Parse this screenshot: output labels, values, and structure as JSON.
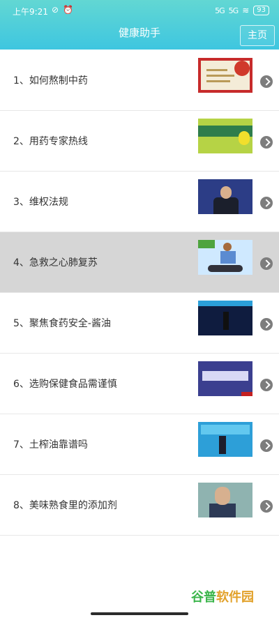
{
  "status_bar": {
    "time": "上午9:21",
    "sig1": "5G",
    "sig2": "5G",
    "wifi": "≋",
    "battery": "93"
  },
  "header": {
    "title": "健康助手",
    "home_label": "主页"
  },
  "items": [
    {
      "label": "1、如何熬制中药"
    },
    {
      "label": "2、用药专家热线"
    },
    {
      "label": "3、维权法规"
    },
    {
      "label": "4、急救之心肺复苏",
      "selected": true
    },
    {
      "label": "5、聚焦食药安全-酱油"
    },
    {
      "label": "6、选购保健食品需谨慎"
    },
    {
      "label": "7、土榨油靠谱吗"
    },
    {
      "label": "8、美味熟食里的添加剂"
    }
  ],
  "icons": {
    "chevron": "chevron-right-icon"
  },
  "watermark": {
    "part1": "谷普",
    "part2": "软件园"
  },
  "colors": {
    "header_gradient_top": "#62d7d3",
    "header_gradient_bottom": "#3ec6e0",
    "selected_row": "#d6d6d6",
    "watermark_green": "#3ab54a"
  }
}
